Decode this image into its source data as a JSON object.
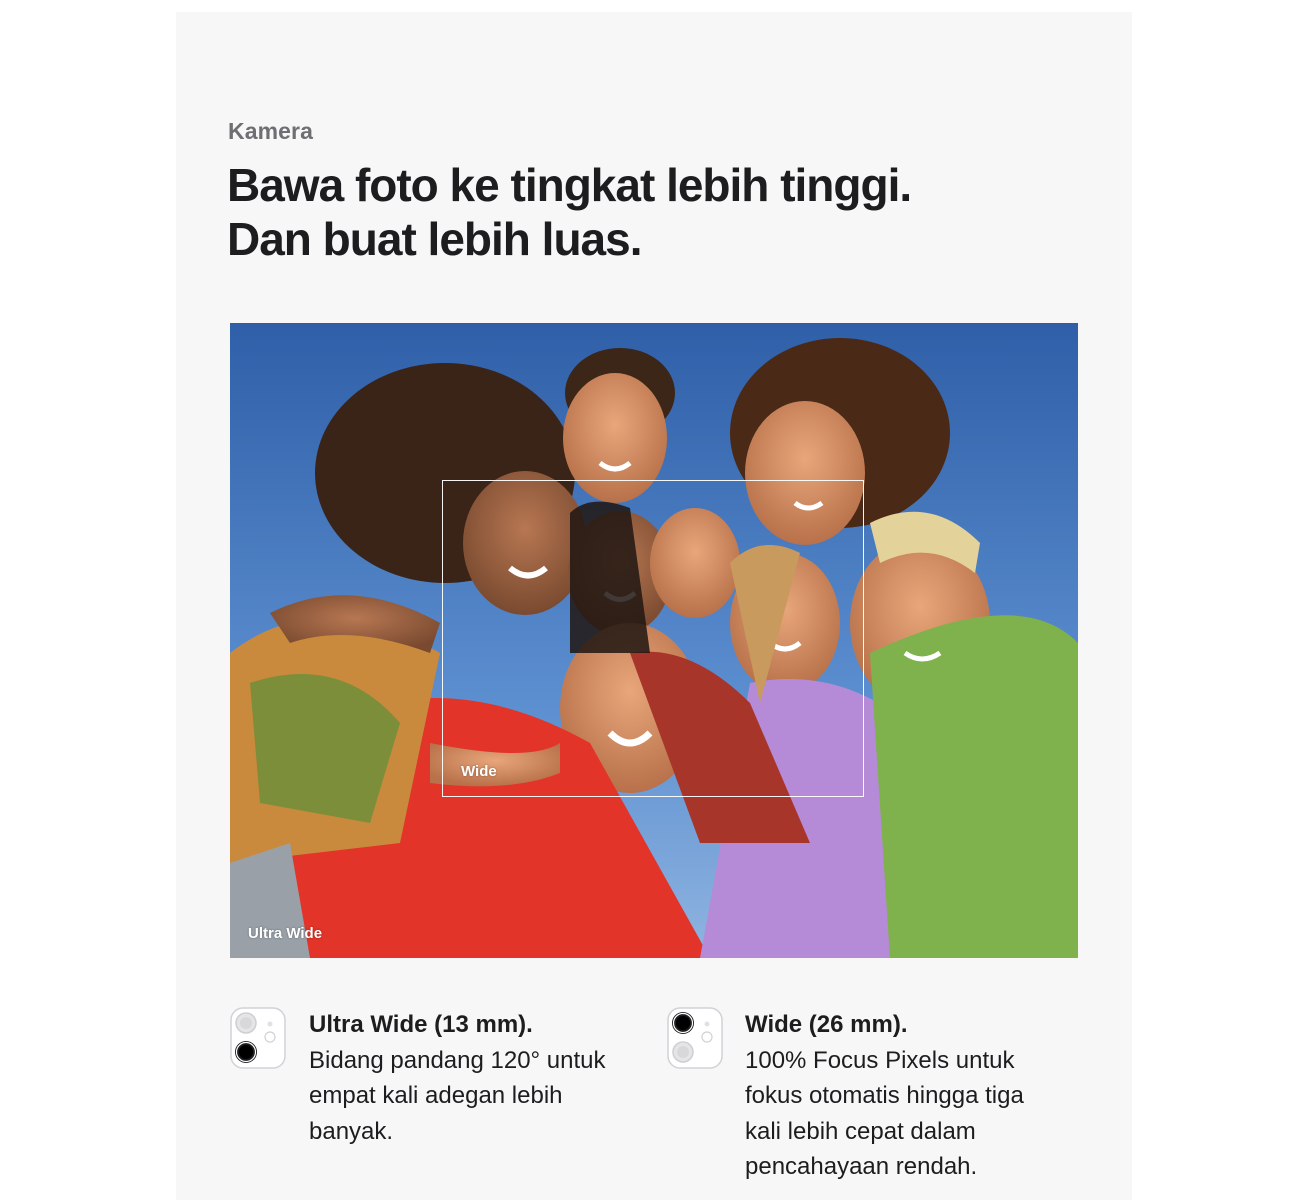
{
  "section": {
    "eyebrow": "Kamera",
    "headline_line1": "Bawa foto ke tingkat lebih tinggi.",
    "headline_line2": "Dan buat lebih luas."
  },
  "photo": {
    "label_wide": "Wide",
    "label_ultra_wide": "Ultra Wide"
  },
  "features": [
    {
      "icon": "camera-ultra-wide-icon",
      "title": "Ultra Wide (13 mm).",
      "description": "Bidang pandang 120° untuk empat kali adegan lebih banyak."
    },
    {
      "icon": "camera-wide-icon",
      "title": "Wide (26 mm).",
      "description": "100% Focus Pixels untuk fokus otomatis hingga tiga kali lebih cepat dalam pencahayaan rendah."
    }
  ],
  "colors": {
    "card_background": "#f7f7f7",
    "text_primary": "#1d1d1f",
    "text_secondary": "#6e6e73",
    "sky": "#3d6bb0"
  }
}
